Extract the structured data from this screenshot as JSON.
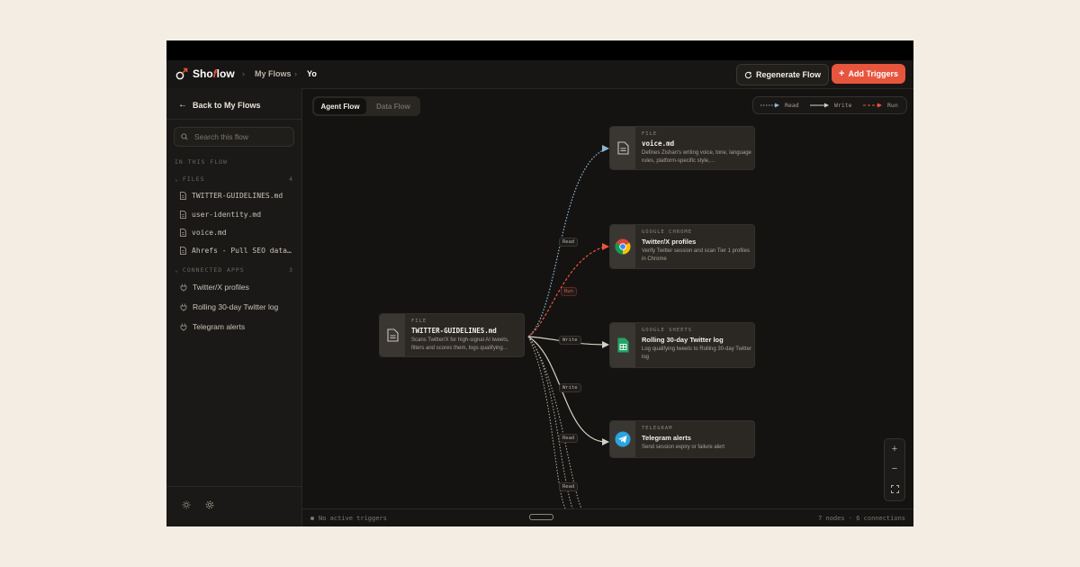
{
  "topbar": {
    "logo_prefix": "Sho",
    "logo_f": "f",
    "logo_suffix": "low",
    "crumbs": [
      "My Flows",
      "Yo"
    ],
    "regenerate_label": "Regenerate Flow",
    "add_triggers_label": "Add Triggers"
  },
  "sidebar": {
    "back_label": "Back to My Flows",
    "search_placeholder": "Search this flow",
    "in_this_flow": "IN THIS FLOW",
    "files_heading": "FILES",
    "files_count": "4",
    "files": [
      "TWITTER-GUIDELINES.md",
      "user-identity.md",
      "voice.md",
      "Ahrefs - Pull SEO data …"
    ],
    "apps_heading": "CONNECTED APPS",
    "apps_count": "3",
    "apps": [
      "Twitter/X profiles",
      "Rolling 30-day Twitter log",
      "Telegram alerts"
    ]
  },
  "canvas": {
    "tabs": [
      "Agent Flow",
      "Data Flow"
    ],
    "active_tab": "Agent Flow",
    "legend": {
      "read": "Read",
      "write": "Write",
      "run": "Run"
    },
    "colors": {
      "read": "#8fb4cf",
      "write": "#d5d0c6",
      "run": "#e8553e",
      "accent": "#e8553e"
    },
    "source": {
      "kind": "FILE",
      "title": "TWITTER-GUIDELINES.md",
      "desc": "Scans Twitter/X for high-signal AI tweets, filters and scores them, logs qualifying…",
      "icon": "document-icon"
    },
    "targets": [
      {
        "kind": "FILE",
        "title": "voice.md",
        "desc": "Defines Zishan's writing voice, tone, language rules, platform-specific style,…",
        "icon": "document-icon"
      },
      {
        "kind": "GOOGLE CHROME",
        "title": "Twitter/X profiles",
        "desc": "Verify Twitter session and scan Tier 1 profiles in Chrome",
        "icon": "chrome-icon"
      },
      {
        "kind": "GOOGLE SHEETS",
        "title": "Rolling 30-day Twitter log",
        "desc": "Log qualifying tweets to Rolling 30-day Twitter log",
        "icon": "sheets-icon"
      },
      {
        "kind": "TELEGRAM",
        "title": "Telegram alerts",
        "desc": "Send session expiry or failure alert",
        "icon": "telegram-icon"
      }
    ],
    "edge_labels": [
      "Read",
      "Run",
      "Write",
      "Write",
      "Read",
      "Read"
    ]
  },
  "zoom": {
    "in": "+",
    "out": "−"
  },
  "status": {
    "left": "No active triggers",
    "right": "7 nodes · 6 connections"
  }
}
